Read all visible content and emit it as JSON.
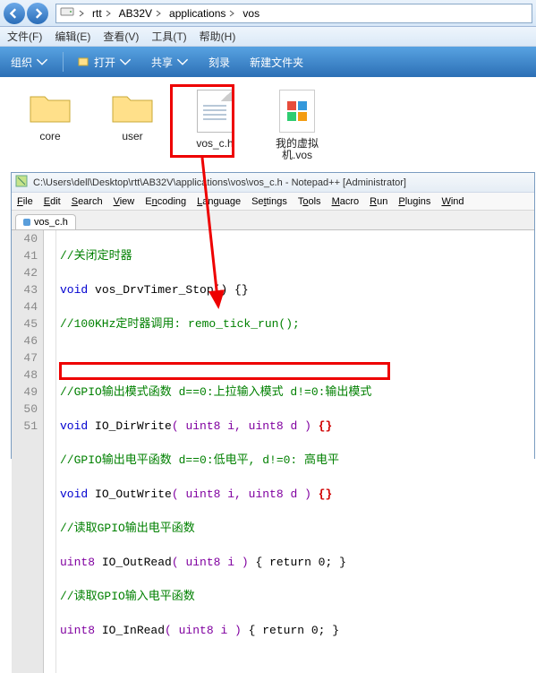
{
  "breadcrumb": {
    "items": [
      "rtt",
      "AB32V",
      "applications",
      "vos"
    ]
  },
  "classicMenu": {
    "file": "文件(F)",
    "edit": "编辑(E)",
    "view": "查看(V)",
    "tools": "工具(T)",
    "help": "帮助(H)"
  },
  "toolbar": {
    "organize": "组织",
    "open": "打开",
    "share": "共享",
    "burn": "刻录",
    "newfolder": "新建文件夹"
  },
  "files": {
    "core": "core",
    "user": "user",
    "vos_c_h": "vos_c.h",
    "myvm": "我的虚拟机.vos"
  },
  "notepad": {
    "title": "C:\\Users\\dell\\Desktop\\rtt\\AB32V\\applications\\vos\\vos_c.h - Notepad++ [Administrator]",
    "menu": {
      "file": "File",
      "edit": "Edit",
      "search": "Search",
      "view": "View",
      "encoding": "Encoding",
      "language": "Language",
      "settings": "Settings",
      "tools": "Tools",
      "macro": "Macro",
      "run": "Run",
      "plugins": "Plugins",
      "window": "Wind"
    },
    "tab": "vos_c.h",
    "lines": {
      "n40": "40",
      "n41": "41",
      "n42": "42",
      "n43": "43",
      "n44": "44",
      "n45": "45",
      "n46": "46",
      "n47": "47",
      "n48": "48",
      "n49": "49",
      "n50": "50",
      "n51": "51",
      "l40": "//关闭定时器",
      "l41_kw": "void",
      "l41_fn": " vos_DrvTimer_Stop",
      "l41_rest": "() {}",
      "l42": "//100KHz定时器调用: remo_tick_run();",
      "l43": "",
      "l44": "//GPIO输出模式函数 d==0:上拉输入模式 d!=0:输出模式",
      "l45_kw": "void",
      "l45_fn": " IO_DirWrite",
      "l45_p": "( uint8 i, uint8 d ) ",
      "l45_b": "{}",
      "l46": "//GPIO输出电平函数 d==0:低电平, d!=0: 高电平",
      "l47_kw": "void",
      "l47_fn": " IO_OutWrite",
      "l47_p": "( uint8 i, uint8 d ) ",
      "l47_b": "{}",
      "l48": "//读取GPIO输出电平函数",
      "l49_ty": "uint8",
      "l49_fn": " IO_OutRead",
      "l49_p": "( uint8 i ) ",
      "l49_r": "{ return 0; }",
      "l50": "//读取GPIO输入电平函数",
      "l51_ty": "uint8",
      "l51_fn": " IO_InRead",
      "l51_p": "( uint8 i ) ",
      "l51_r": "{ return 0; }"
    }
  }
}
